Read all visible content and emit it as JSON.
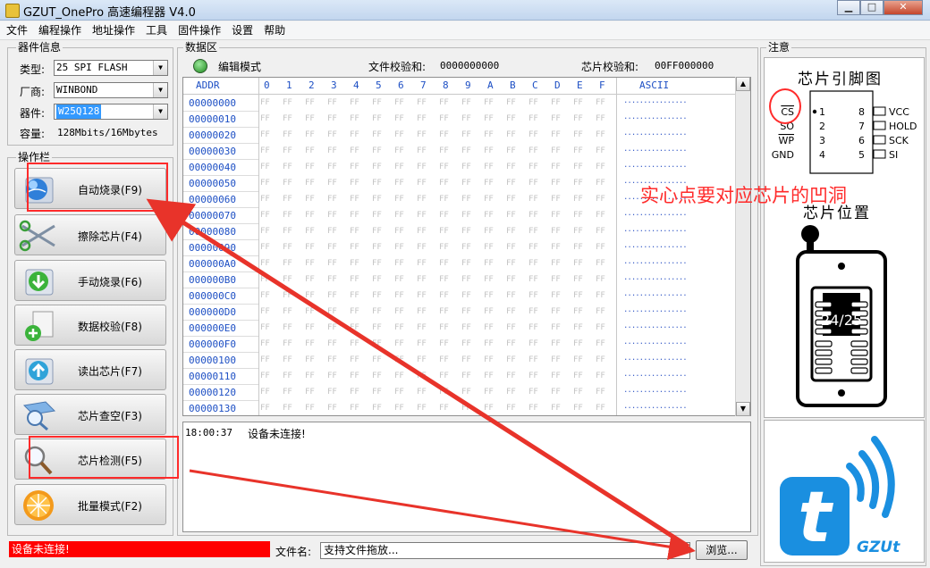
{
  "window": {
    "title": "GZUT_OnePro 高速编程器 V4.0"
  },
  "menu": [
    "文件",
    "编程操作",
    "地址操作",
    "工具",
    "固件操作",
    "设置",
    "帮助"
  ],
  "device_info": {
    "group_title": "器件信息",
    "type_label": "类型:",
    "type_value": "25 SPI FLASH",
    "vendor_label": "厂商:",
    "vendor_value": "WINBOND",
    "device_label": "器件:",
    "device_value": "W25Q128",
    "capacity_label": "容量:",
    "capacity_value": "128Mbits/16Mbytes"
  },
  "ops": {
    "group_title": "操作栏",
    "buttons": [
      {
        "label": "自动烧录(F9)",
        "icon": "globe-icon"
      },
      {
        "label": "擦除芯片(F4)",
        "icon": "scissors-icon"
      },
      {
        "label": "手动烧录(F6)",
        "icon": "download-arrow-icon"
      },
      {
        "label": "数据校验(F8)",
        "icon": "document-plus-icon"
      },
      {
        "label": "读出芯片(F7)",
        "icon": "upload-arrow-icon"
      },
      {
        "label": "芯片查空(F3)",
        "icon": "book-magnifier-icon"
      },
      {
        "label": "芯片检测(F5)",
        "icon": "magnifier-icon"
      },
      {
        "label": "批量模式(F2)",
        "icon": "orange-slice-icon"
      }
    ]
  },
  "data_area": {
    "group_title": "数据区",
    "mode_label": "编辑模式",
    "file_checksum_label": "文件校验和:",
    "file_checksum": "0000000000",
    "chip_checksum_label": "芯片校验和:",
    "chip_checksum": "00FF000000",
    "addr_header": "ADDR",
    "hex_headers": [
      "0",
      "1",
      "2",
      "3",
      "4",
      "5",
      "6",
      "7",
      "8",
      "9",
      "A",
      "B",
      "C",
      "D",
      "E",
      "F"
    ],
    "ascii_header": "ASCII",
    "addresses": [
      "00000000",
      "00000010",
      "00000020",
      "00000030",
      "00000040",
      "00000050",
      "00000060",
      "00000070",
      "00000080",
      "00000090",
      "000000A0",
      "000000B0",
      "000000C0",
      "000000D0",
      "000000E0",
      "000000F0",
      "00000100",
      "00000110",
      "00000120",
      "00000130"
    ],
    "cell_value": "FF",
    "ascii_value": "................"
  },
  "log": {
    "time": "18:00:37",
    "message": "设备未连接!"
  },
  "status": {
    "message": "设备未连接!"
  },
  "file": {
    "label": "文件名:",
    "value": "支持文件拖放...",
    "browse_label": "浏览..."
  },
  "notice": {
    "group_title": "注意",
    "pinout_title": "芯片引脚图",
    "left_pins": [
      {
        "name": "CS",
        "num": "1"
      },
      {
        "name": "SO",
        "num": "2"
      },
      {
        "name": "WP",
        "num": "3"
      },
      {
        "name": "GND",
        "num": "4"
      }
    ],
    "right_pins": [
      {
        "name": "VCC",
        "num": "8"
      },
      {
        "name": "HOLD",
        "num": "7"
      },
      {
        "name": "SCK",
        "num": "6"
      },
      {
        "name": "SI",
        "num": "5"
      }
    ],
    "position_title": "芯片位置",
    "socket_label": "24/25",
    "logo_text": "GZUt",
    "logo_letter": "t"
  },
  "annotation": {
    "text": "实心点要对应芯片的凹洞"
  },
  "colors": {
    "accent_red": "#ff2b2b",
    "addr_blue": "#1d4fc4",
    "status_red": "#ff0000",
    "logo_blue": "#1a8fe0"
  }
}
